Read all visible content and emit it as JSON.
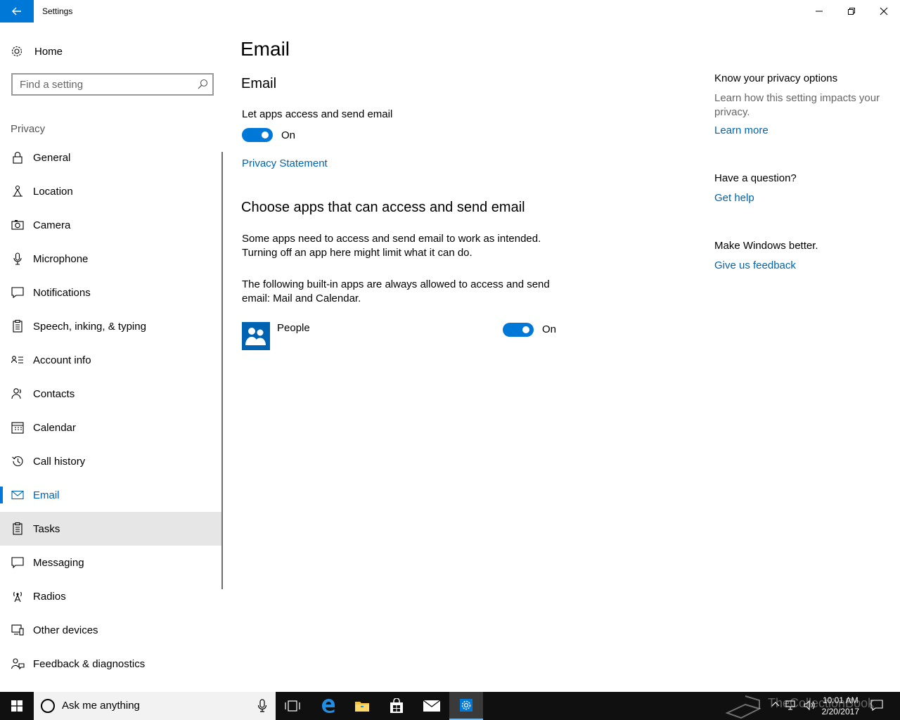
{
  "window": {
    "title": "Settings"
  },
  "sidebar": {
    "home_label": "Home",
    "search_placeholder": "Find a setting",
    "section_label": "Privacy",
    "items": [
      {
        "label": "General",
        "icon": "lock-icon"
      },
      {
        "label": "Location",
        "icon": "location-icon"
      },
      {
        "label": "Camera",
        "icon": "camera-icon"
      },
      {
        "label": "Microphone",
        "icon": "microphone-icon"
      },
      {
        "label": "Notifications",
        "icon": "notifications-icon"
      },
      {
        "label": "Speech, inking, & typing",
        "icon": "clipboard-icon"
      },
      {
        "label": "Account info",
        "icon": "account-info-icon"
      },
      {
        "label": "Contacts",
        "icon": "contacts-icon"
      },
      {
        "label": "Calendar",
        "icon": "calendar-icon"
      },
      {
        "label": "Call history",
        "icon": "history-icon"
      },
      {
        "label": "Email",
        "icon": "mail-icon"
      },
      {
        "label": "Tasks",
        "icon": "tasks-icon"
      },
      {
        "label": "Messaging",
        "icon": "message-icon"
      },
      {
        "label": "Radios",
        "icon": "radio-tower-icon"
      },
      {
        "label": "Other devices",
        "icon": "devices-icon"
      },
      {
        "label": "Feedback & diagnostics",
        "icon": "feedback-icon"
      }
    ],
    "selected": "Email",
    "hovered": "Tasks"
  },
  "main": {
    "page_title": "Email",
    "section_title": "Email",
    "toggle_label": "Let apps access and send email",
    "toggle_state": "On",
    "privacy_link": "Privacy Statement",
    "choose_title": "Choose apps that can access and send email",
    "para1_line1": "Some apps need to access and send email to work as intended.",
    "para1_line2": "Turning off an app here might limit what it can do.",
    "para2_line1": "The following built-in apps are always allowed to access and send",
    "para2_line2": "email: Mail and Calendar.",
    "apps": [
      {
        "name": "People",
        "state": "On"
      }
    ]
  },
  "right_panel": {
    "privacy_head": "Know your privacy options",
    "privacy_text_line1": "Learn how this setting impacts your",
    "privacy_text_line2": "privacy.",
    "learn_more": "Learn more",
    "question_head": "Have a question?",
    "get_help": "Get help",
    "better_head": "Make Windows better.",
    "feedback_link": "Give us feedback"
  },
  "taskbar": {
    "search_text": "Ask me anything",
    "time": "10:01 AM",
    "date": "2/20/2017",
    "watermark": "TheCollectionBook"
  },
  "colors": {
    "accent": "#0078d7",
    "link": "#0063b1",
    "taskbar": "#101010"
  }
}
